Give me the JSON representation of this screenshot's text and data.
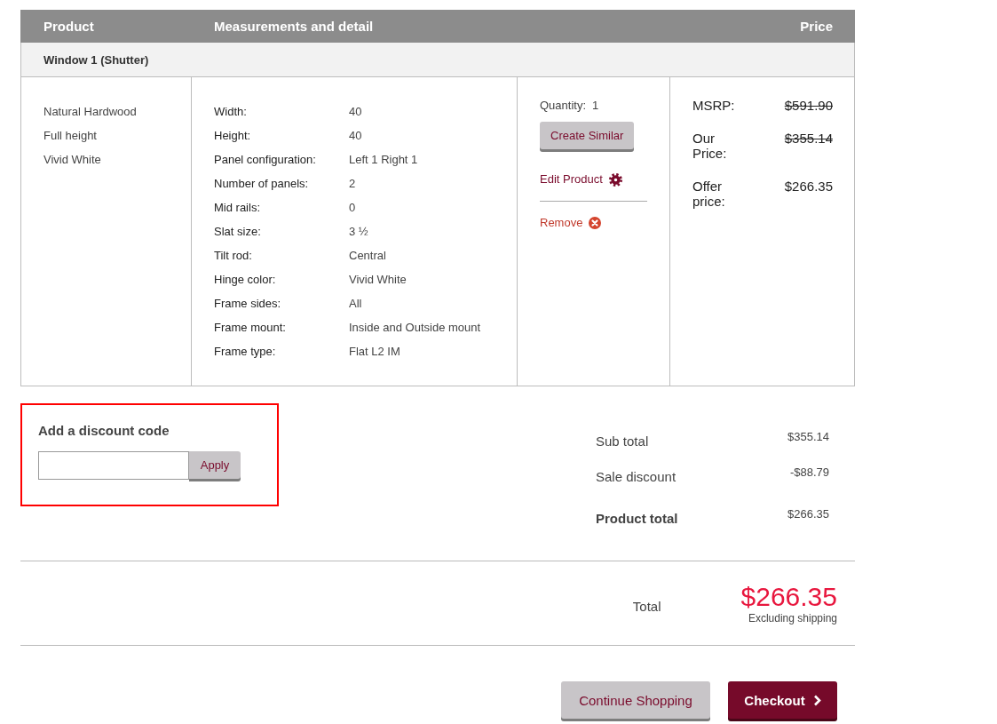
{
  "table": {
    "columns": [
      "Product",
      "Measurements and detail",
      "Price"
    ],
    "item": {
      "title": "Window 1 (Shutter)",
      "attributes": [
        "Natural Hardwood",
        "Full height",
        "Vivid White"
      ],
      "specs": [
        {
          "label": "Width:",
          "value": "40"
        },
        {
          "label": "Height:",
          "value": "40"
        },
        {
          "label": "Panel configuration:",
          "value": "Left 1 Right 1"
        },
        {
          "label": "Number of panels:",
          "value": "2"
        },
        {
          "label": "Mid rails:",
          "value": "0"
        },
        {
          "label": "Slat size:",
          "value": "3 ½"
        },
        {
          "label": "Tilt rod:",
          "value": "Central"
        },
        {
          "label": "Hinge color:",
          "value": "Vivid White"
        },
        {
          "label": "Frame sides:",
          "value": "All"
        },
        {
          "label": "Frame mount:",
          "value": "Inside and Outside mount"
        },
        {
          "label": "Frame type:",
          "value": "Flat L2 IM"
        }
      ],
      "quantity_label": "Quantity:",
      "quantity": "1",
      "actions": [
        {
          "label": "Create Similar",
          "kind": "button"
        },
        {
          "label": "Edit Product",
          "kind": "edit"
        },
        {
          "label": "Remove",
          "kind": "remove"
        }
      ],
      "prices": [
        {
          "label": "MSRP:",
          "value": "$591.90",
          "struck": true
        },
        {
          "label": "Our Price:",
          "value": "$355.14",
          "struck": true
        },
        {
          "label": "Offer price:",
          "value": "$266.35",
          "struck": false
        }
      ]
    }
  },
  "discount": {
    "title": "Add a discount code",
    "highlighted": true,
    "button": "Apply"
  },
  "summary": [
    {
      "label": "Sub total",
      "value": "$355.14",
      "bold": false
    },
    {
      "label": "Sale discount",
      "value": "-$88.79",
      "bold": false
    },
    {
      "label": "Product total",
      "value": "$266.35",
      "bold": true
    }
  ],
  "total": {
    "label": "Total",
    "value": "$266.35",
    "note": "Excluding shipping"
  },
  "buttons": [
    {
      "label": "Continue Shopping",
      "kind": "secondary"
    },
    {
      "label": "Checkout",
      "kind": "primary"
    }
  ]
}
